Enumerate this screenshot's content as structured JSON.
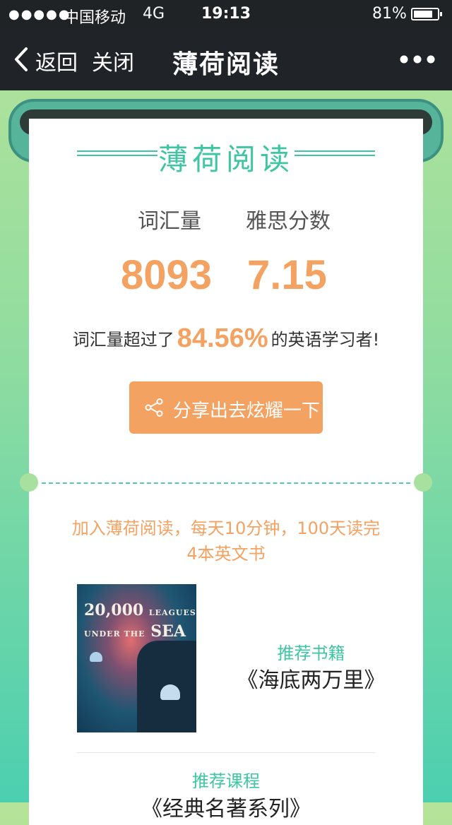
{
  "status_bar": {
    "signal_dots": "●●●●●",
    "carrier": "中国移动",
    "network": "4G",
    "time": "19:13",
    "battery_percent": "81%",
    "battery_level": 0.81
  },
  "nav_bar": {
    "back_label": "返回",
    "close_label": "关闭",
    "title": "薄荷阅读"
  },
  "card": {
    "header_title": "薄荷阅读",
    "vocab_label": "词汇量",
    "ielts_label": "雅思分数",
    "vocab_value": "8093",
    "ielts_value": "7.15",
    "percent_prefix": "词汇量超过了",
    "percent_value": "84.56%",
    "percent_suffix": "的英语学习者!",
    "share_button_label": "分享出去炫耀一下",
    "promo_text": "加入薄荷阅读，每天10分钟，100天读完4本英文书",
    "book_cover": {
      "title_line1": "20,000",
      "title_line1_small": "LEAGUES",
      "title_line2_small": "UNDER THE",
      "title_line2": "SEA"
    },
    "book_label": "推荐书籍",
    "book_title": "《海底两万里》",
    "course_label": "推荐课程",
    "course_title": "《经典名著系列》"
  },
  "colors": {
    "accent_green": "#3ec6a3",
    "accent_orange": "#f4a261",
    "nav_bg": "#202428"
  },
  "icons": [
    "back-chevron-icon",
    "more-dots-icon",
    "share-icon",
    "battery-icon"
  ]
}
